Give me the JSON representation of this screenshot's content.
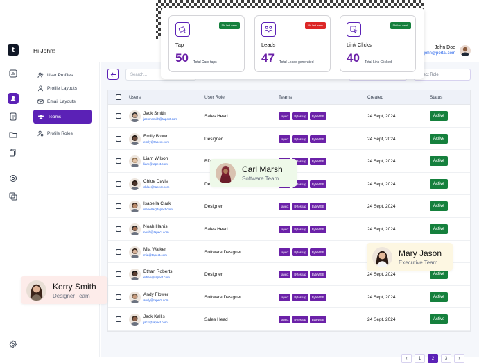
{
  "header": {
    "greeting": "Hi John!",
    "user_name": "John Doe",
    "user_email": "john@portal.com"
  },
  "menu": [
    {
      "label": "User Profiles"
    },
    {
      "label": "Profile Layouts"
    },
    {
      "label": "Email Layouts"
    },
    {
      "label": "Teams"
    },
    {
      "label": "Profile Roles"
    }
  ],
  "search": {
    "placeholder": "Search..."
  },
  "filter_role": {
    "value": "Select Role"
  },
  "table": {
    "headers": [
      "Users",
      "User Role",
      "Teams",
      "Created",
      "Status"
    ],
    "rows": [
      {
        "name": "Jack Smith",
        "email": "jackmsmith@tapect.com",
        "role": "Sales Head",
        "tags": [
          "tapect",
          "Bytesnap",
          "ByteWEB"
        ],
        "created": "24 Sept, 2024",
        "status": "Active"
      },
      {
        "name": "Emily Brown",
        "email": "emily@tapect.com",
        "role": "Designer",
        "tags": [
          "tapect",
          "Bytesnap",
          "ByteWEB"
        ],
        "created": "24 Sept, 2024",
        "status": "Active"
      },
      {
        "name": "Liam Wilson",
        "email": "liam@tapect.com",
        "role": "BDE",
        "tags": [
          "tapect",
          "Bytesnap",
          "ByteWEB"
        ],
        "created": "24 Sept, 2024",
        "status": "Active"
      },
      {
        "name": "Chloe Davis",
        "email": "chloe@tapect.com",
        "role": "Designer",
        "tags": [
          "tapect",
          "Bytesnap",
          "ByteWEB"
        ],
        "created": "24 Sept, 2024",
        "status": "Active"
      },
      {
        "name": "Isabella Clark",
        "email": "isabella@tapect.com",
        "role": "Designer",
        "tags": [
          "tapect",
          "Bytesnap",
          "ByteWEB"
        ],
        "created": "24 Sept, 2024",
        "status": "Active"
      },
      {
        "name": "Noah Harris",
        "email": "noah@tapect.com",
        "role": "Sales Head",
        "tags": [
          "tapect",
          "Bytesnap",
          "ByteWEB"
        ],
        "created": "24 Sept, 2024",
        "status": "Active"
      },
      {
        "name": "Mia Walker",
        "email": "mia@tapect.com",
        "role": "Software Designer",
        "tags": [
          "tapect",
          "Bytesnap",
          "ByteWEB"
        ],
        "created": "24 Sept, 2024",
        "status": "Active"
      },
      {
        "name": "Ethan Roberts",
        "email": "ethan@tapect.com",
        "role": "Designer",
        "tags": [
          "tapect",
          "Bytesnap",
          "ByteWEB"
        ],
        "created": "24 Sept, 2024",
        "status": "Active"
      },
      {
        "name": "Andy Flower",
        "email": "andy@tapect.com",
        "role": "Software Designer",
        "tags": [
          "tapect",
          "Bytesnap",
          "ByteWEB"
        ],
        "created": "24 Sept, 2024",
        "status": "Active"
      },
      {
        "name": "Jack Kallis",
        "email": "jack@tapect.com",
        "role": "Sales Head",
        "tags": [
          "tapect",
          "Bytesnap",
          "ByteWEB"
        ],
        "created": "24 Sept, 2024",
        "status": "Active"
      }
    ]
  },
  "pagination": {
    "pages": [
      "1",
      "2",
      "3"
    ],
    "current": "2",
    "prev": "‹",
    "next": "›"
  },
  "stats": [
    {
      "title": "Tap",
      "value": "50",
      "caption": "Total Card taps",
      "badge": "5% last week",
      "badge_color": "#15803d"
    },
    {
      "title": "Leads",
      "value": "47",
      "caption": "Total Leads generated",
      "badge": "3% last week",
      "badge_color": "#dc2626"
    },
    {
      "title": "Link Clicks",
      "value": "40",
      "caption": "Total Link Clicked",
      "badge": "5% last week",
      "badge_color": "#15803d"
    }
  ],
  "floating_cards": [
    {
      "name": "Carl Marsh",
      "role": "Software Team",
      "bg": "#eef9e9"
    },
    {
      "name": "Mary Jason",
      "role": "Executive Team",
      "bg": "#fdf7e2"
    },
    {
      "name": "Kerry Smith",
      "role": "Designer Team",
      "bg": "#fdecea"
    }
  ],
  "colors": {
    "accent": "#5b21b6",
    "status_active": "#15803d",
    "link": "#2563eb"
  },
  "icons": {
    "rail": [
      "chart-icon",
      "user-icon",
      "document-icon",
      "folder-icon",
      "copy-icon",
      "settings-icon",
      "layers-icon",
      "gear-icon"
    ],
    "menu": [
      "users-icon",
      "user-icon",
      "mail-icon",
      "team-icon",
      "user-gear-icon"
    ]
  }
}
